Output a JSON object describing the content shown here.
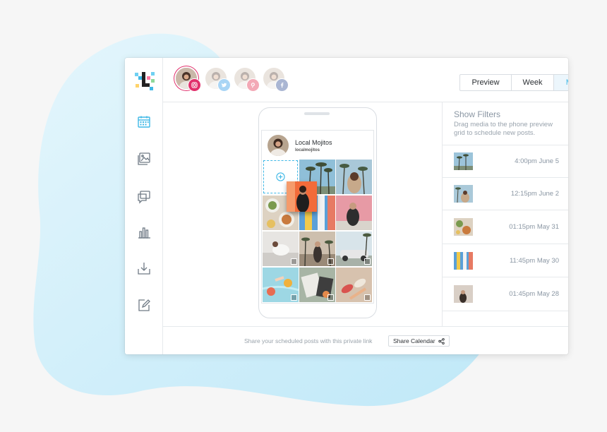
{
  "accounts": [
    {
      "network": "instagram",
      "icon": "instagram-icon",
      "active": true
    },
    {
      "network": "twitter",
      "icon": "twitter-icon",
      "active": false
    },
    {
      "network": "pinterest",
      "icon": "pinterest-icon",
      "active": false
    },
    {
      "network": "facebook",
      "icon": "facebook-icon",
      "active": false
    }
  ],
  "view_toggle": {
    "preview_label": "Preview",
    "week_label": "Week",
    "month_label": "Month",
    "selected": "Month"
  },
  "sidebar": {
    "items": [
      {
        "icon": "calendar-icon",
        "active": true
      },
      {
        "icon": "media-library-icon",
        "active": false
      },
      {
        "icon": "conversations-icon",
        "active": false
      },
      {
        "icon": "analytics-icon",
        "active": false
      },
      {
        "icon": "download-icon",
        "active": false
      },
      {
        "icon": "edit-icon",
        "active": false
      }
    ]
  },
  "phone_preview": {
    "profile_name": "Local Mojitos",
    "profile_handle": "localmojitos"
  },
  "filters": {
    "title": "Show Filters",
    "description": "Drag media to the phone preview grid to schedule new posts."
  },
  "scheduled_posts": [
    {
      "time": "4:00pm June 5"
    },
    {
      "time": "12:15pm June 2"
    },
    {
      "time": "01:15pm May 31"
    },
    {
      "time": "11:45pm May 30"
    },
    {
      "time": "01:45pm May 28"
    }
  ],
  "footer": {
    "share_text": "Share your scheduled posts with this private link",
    "share_button_label": "Share Calendar"
  },
  "colors": {
    "accent": "#3fb8e6",
    "instagram": "#e1306c",
    "twitter": "#55acee",
    "pinterest": "#e60023",
    "facebook": "#3b5998",
    "backdrop": "#c6ebf8"
  }
}
